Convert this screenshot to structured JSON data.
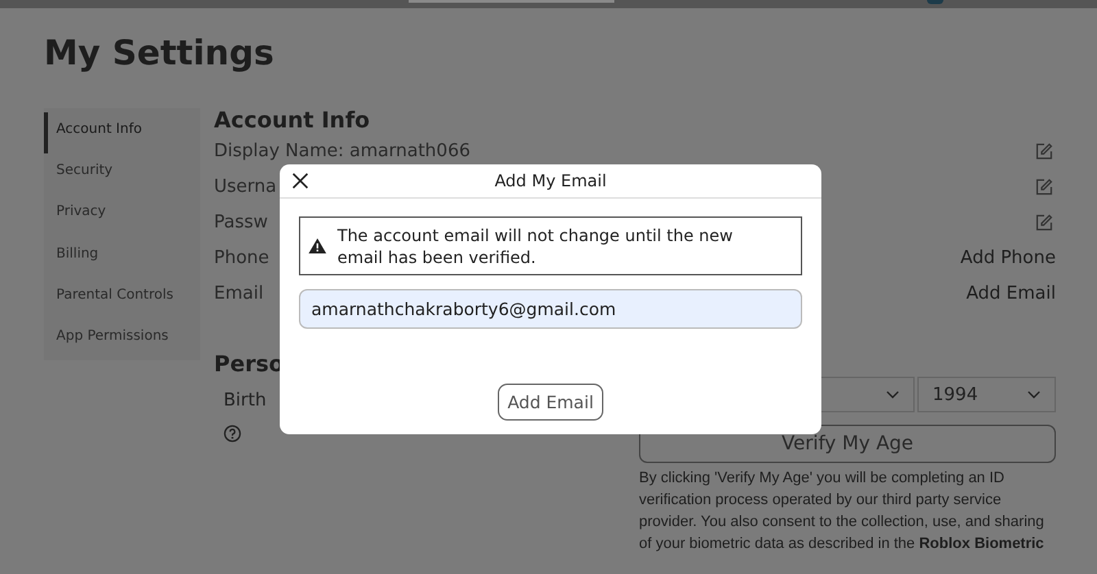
{
  "page": {
    "title": "My Settings"
  },
  "sidebar": {
    "items": [
      {
        "label": "Account Info",
        "selected": true
      },
      {
        "label": "Security",
        "selected": false
      },
      {
        "label": "Privacy",
        "selected": false
      },
      {
        "label": "Billing",
        "selected": false
      },
      {
        "label": "Parental Controls",
        "selected": false
      },
      {
        "label": "App Permissions",
        "selected": false
      }
    ]
  },
  "account_info": {
    "heading": "Account Info",
    "rows": [
      {
        "label": "Display Name: amarnath066",
        "action": {
          "kind": "edit"
        }
      },
      {
        "label": "Userna",
        "action": {
          "kind": "edit"
        }
      },
      {
        "label": "Passw",
        "action": {
          "kind": "edit"
        }
      },
      {
        "label": "Phone",
        "action": {
          "kind": "link",
          "text": "Add Phone"
        }
      },
      {
        "label": "Email",
        "action": {
          "kind": "link",
          "text": "Add Email"
        }
      }
    ]
  },
  "personal": {
    "heading": "Perso",
    "birthday_label": "Birth",
    "year": "1994",
    "verify_button": "Verify My Age",
    "notice": "By clicking 'Verify My Age' you will be completing an ID verification process operated by our third party service provider. You also consent to the collection, use, and sharing of your biometric data as described in the **Roblox Biometric**"
  },
  "dialog": {
    "title": "Add My Email",
    "warning": "The account email will not change until the new email has been verified.",
    "email_value": "amarnathchakraborty6@gmail.com",
    "button": "Add Email"
  }
}
